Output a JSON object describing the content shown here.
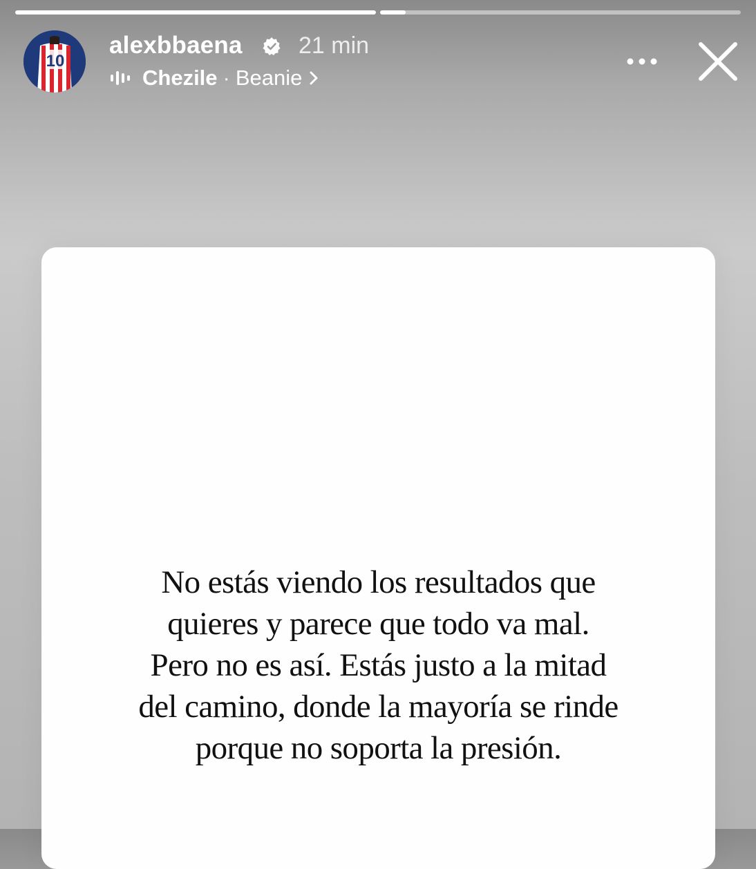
{
  "story": {
    "progress": [
      {
        "name": "segment-1",
        "fill": 1.0
      },
      {
        "name": "segment-2",
        "fill": 0.07
      }
    ],
    "header": {
      "avatar_icon": "avatar-jersey-10",
      "username": "alexbbaena",
      "verified_icon": "verified-badge-icon",
      "time": "21 min",
      "music_icon": "music-bars-icon",
      "artist": "Chezile",
      "separator": "·",
      "song": "Beanie",
      "chevron_icon": "chevron-right-icon",
      "more_icon": "more-options-icon",
      "close_icon": "close-icon"
    },
    "quote_lines": [
      "No estás viendo los resultados que",
      "quieres y parece que todo va mal.",
      "Pero no es así. Estás justo a la mitad",
      "del camino, donde la mayoría se rinde",
      "porque no soporta la presión."
    ]
  },
  "colors": {
    "progress_active": "#ffffff",
    "progress_inactive": "rgba(255,255,255,0.45)",
    "card_bg": "#fefefe",
    "quote_text": "#111111"
  }
}
